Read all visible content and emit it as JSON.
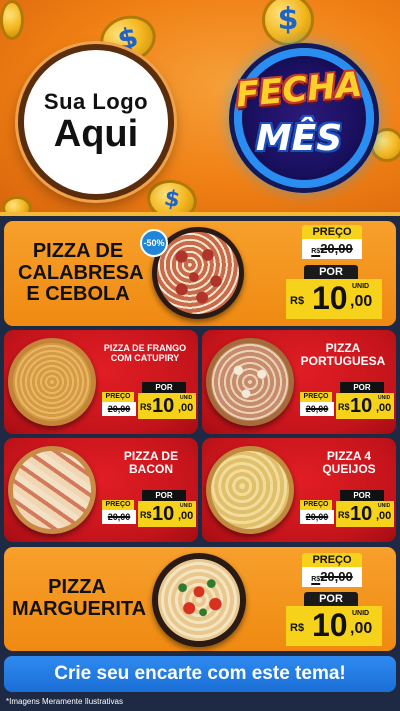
{
  "header": {
    "logo_line1": "Sua Logo",
    "logo_line2": "Aqui",
    "badge_top": "FECHA",
    "badge_bottom": "MÊS",
    "coin_symbol": "$"
  },
  "currency": "R$",
  "unit": "UNID",
  "preco_label": "PREÇO",
  "por_label": "POR",
  "old_price": "20,00",
  "new_price_int": "10",
  "new_price_dec": ",00",
  "products": {
    "calabresa": {
      "name": "PIZZA DE CALABRESA E CEBOLA",
      "discount": "-50%"
    },
    "frango": {
      "name": "PIZZA DE FRANGO COM CATUPIRY"
    },
    "portuguesa": {
      "name": "PIZZA PORTUGUESA"
    },
    "bacon": {
      "name": "PIZZA DE BACON"
    },
    "queijos": {
      "name": "PIZZA 4 QUEIJOS"
    },
    "marguerita": {
      "name": "PIZZA MARGUERITA"
    }
  },
  "footer": {
    "cta": "Crie seu encarte com este tema!",
    "note": "*Imagens Meramente Ilustrativas"
  },
  "colors": {
    "orange": "#ef8a12",
    "red": "#c4141b",
    "yellow": "#f7d21a",
    "blue": "#1f86d8"
  }
}
